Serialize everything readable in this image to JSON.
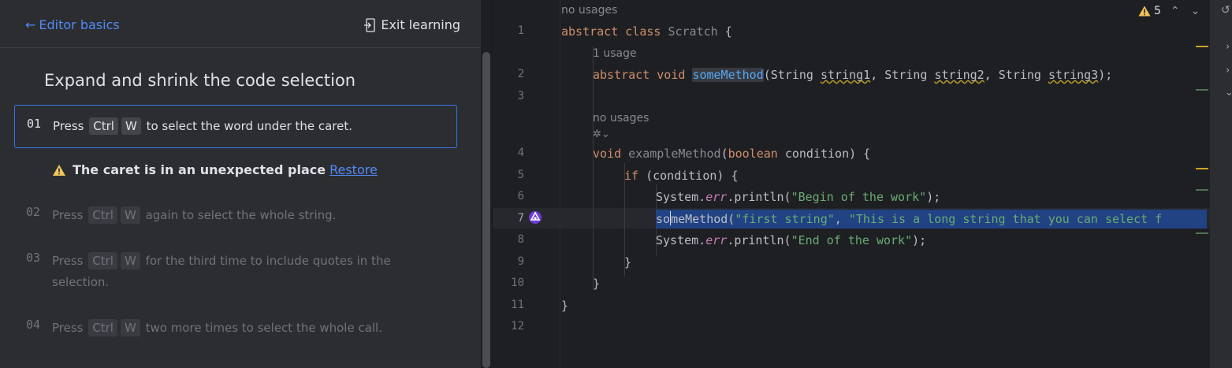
{
  "header": {
    "back_label": "Editor basics",
    "exit_label": "Exit learning"
  },
  "lesson": {
    "title": "Expand and shrink the code selection",
    "warning": {
      "text": "The caret is in an unexpected place",
      "link": "Restore"
    },
    "steps": [
      {
        "num": "01",
        "pre": "Press",
        "keys": [
          "Ctrl",
          "W"
        ],
        "post": "to select the word under the caret.",
        "post2": ""
      },
      {
        "num": "02",
        "pre": "Press",
        "keys": [
          "Ctrl",
          "W"
        ],
        "post": "again to select the whole string.",
        "post2": ""
      },
      {
        "num": "03",
        "pre": "Press",
        "keys": [
          "Ctrl",
          "W"
        ],
        "post": "for the third time to include quotes in the",
        "post2": "selection."
      },
      {
        "num": "04",
        "pre": "Press",
        "keys": [
          "Ctrl",
          "W"
        ],
        "post": "two more times to select the whole call.",
        "post2": ""
      }
    ]
  },
  "editor": {
    "inspection_count": "5",
    "line_numbers": [
      "1",
      "2",
      "3",
      "4",
      "5",
      "6",
      "7",
      "8",
      "9",
      "10",
      "11",
      "12"
    ],
    "hints": {
      "usages_top": "no usages",
      "usage_1": "1 usage",
      "usages_mid": "no usages"
    },
    "code": {
      "l1": {
        "kw": "abstract class ",
        "name": "Scratch",
        "rest": " {"
      },
      "l2": {
        "kw": "abstract void ",
        "fn": "someMethod",
        "open": "(String ",
        "p1": "string1",
        "c1": ", String ",
        "p2": "string2",
        "c2": ", String ",
        "p3": "string3",
        "close": ");"
      },
      "l4": {
        "kw": "void ",
        "fn": "exampleMethod",
        "open": "(",
        "type": "boolean",
        "rest": " condition) {"
      },
      "l5": {
        "kw": "if",
        "rest": " (condition) {"
      },
      "l6": {
        "a": "System.",
        "err": "err",
        "b": ".println(",
        "s": "\"Begin of the work\"",
        "c": ");"
      },
      "l7": {
        "a": "so",
        "b": "meMethod(",
        "s1": "\"first string\"",
        "c": ", ",
        "s2": "\"This is a long string that you can select f"
      },
      "l8": {
        "a": "System.",
        "err": "err",
        "b": ".println(",
        "s": "\"End of the work\"",
        "c": ");"
      },
      "l9": "}",
      "l10": "}",
      "l11": "}"
    }
  },
  "colors": {
    "accent": "#3574f0",
    "link": "#548af7",
    "warning": "#f2c55c",
    "selection": "#214283"
  }
}
